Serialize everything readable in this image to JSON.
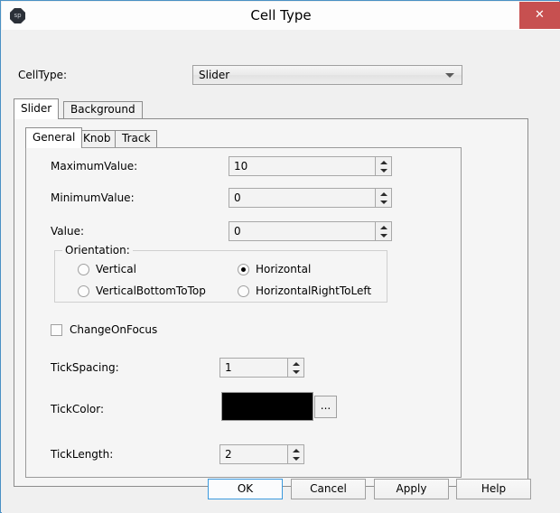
{
  "window": {
    "title": "Cell Type",
    "app_icon": "sp",
    "close_label": "✕",
    "border_color": "#4a90c4",
    "close_color": "#c75050"
  },
  "celltype": {
    "label": "CellType:",
    "value": "Slider",
    "arrow_icon": "chevron-down-icon"
  },
  "outer_tabs": [
    {
      "label": "Slider",
      "active": true
    },
    {
      "label": "Background",
      "active": false
    }
  ],
  "inner_tabs": [
    {
      "label": "General",
      "active": true
    },
    {
      "label": "Knob",
      "active": false
    },
    {
      "label": "Track",
      "active": false
    }
  ],
  "fields": {
    "maximum_value": {
      "label": "MaximumValue:",
      "value": "10"
    },
    "minimum_value": {
      "label": "MinimumValue:",
      "value": "0"
    },
    "value": {
      "label": "Value:",
      "value": "0"
    },
    "tick_spacing": {
      "label": "TickSpacing:",
      "value": "1"
    },
    "tick_length": {
      "label": "TickLength:",
      "value": "2"
    }
  },
  "orientation": {
    "title": "Orientation:",
    "options": [
      {
        "label": "Vertical",
        "checked": false
      },
      {
        "label": "Horizontal",
        "checked": true
      },
      {
        "label": "VerticalBottomToTop",
        "checked": false
      },
      {
        "label": "HorizontalRightToLeft",
        "checked": false
      }
    ]
  },
  "change_on_focus": {
    "label": "ChangeOnFocus",
    "checked": false
  },
  "tick_color": {
    "label": "TickColor:",
    "color": "#000000",
    "browse_label": "..."
  },
  "footer": {
    "ok": "OK",
    "cancel": "Cancel",
    "apply": "Apply",
    "help": "Help"
  }
}
